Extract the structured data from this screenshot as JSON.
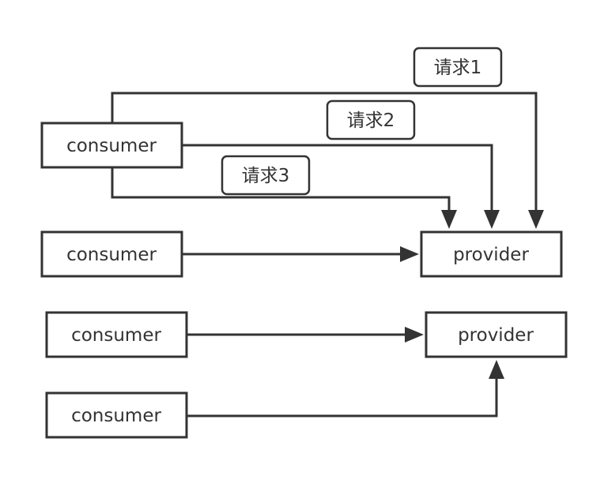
{
  "nodes": {
    "consumer_1": "consumer",
    "consumer_2": "consumer",
    "consumer_3": "consumer",
    "consumer_4": "consumer",
    "provider_1": "provider",
    "provider_2": "provider"
  },
  "requests": {
    "request_1": "请求1",
    "request_2": "请求2",
    "request_3": "请求3"
  },
  "colors": {
    "stroke": "#333333",
    "background": "#ffffff"
  }
}
